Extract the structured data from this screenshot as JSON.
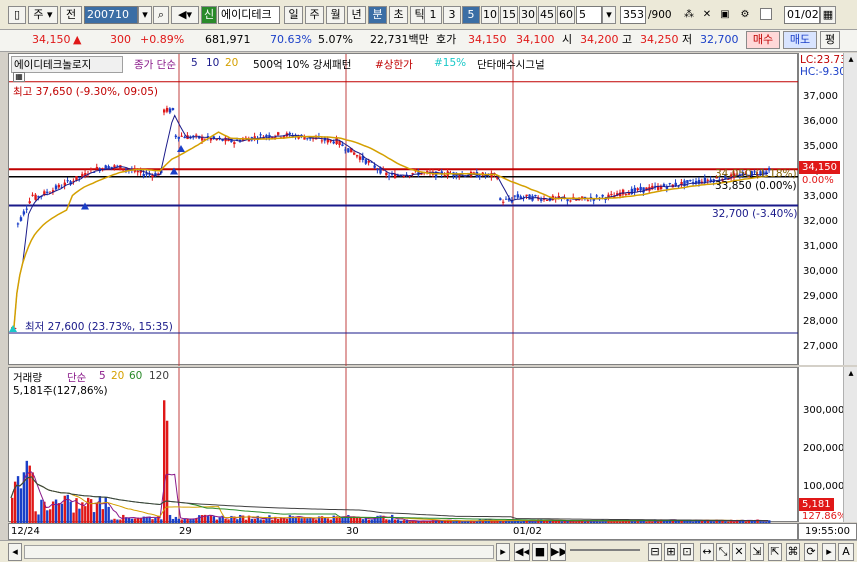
{
  "toolbar": {
    "market": "주",
    "range": "전",
    "code": "200710",
    "shin_label": "신",
    "stock_name": "에이디테크",
    "periods": [
      "일",
      "주",
      "월",
      "년",
      "분",
      "초",
      "틱"
    ],
    "active_period": "분",
    "intervals": [
      "1",
      "3",
      "5",
      "10",
      "15",
      "30",
      "45",
      "60"
    ],
    "active_interval": "5",
    "interval_select": "5",
    "count": "353",
    "count_total": "/900",
    "date": "01/02"
  },
  "quote": {
    "price": "34,150",
    "arrow": "▲",
    "change": "300",
    "change_pct": "+0.89%",
    "volume": "681,971",
    "ratio": "70.63%",
    "ratio2": "5.07%",
    "amount": "22,731백만",
    "hoga_label": "호가",
    "ask": "34,150",
    "bid": "34,100",
    "open_label": "시",
    "open": "34,200",
    "high_label": "고",
    "high": "34,250",
    "low_label": "저",
    "low": "32,700",
    "buy": "매수",
    "sell": "매도",
    "eval": "평"
  },
  "legend": {
    "name": "에이디테크놀로지",
    "ma_label": "종가 단순",
    "ma5": "5",
    "ma10": "10",
    "ma20": "20",
    "pattern": "500억 10% 강세패턴",
    "upper": "#상한가",
    "pct15": "#15%",
    "signal": "단타매수시그널"
  },
  "price_panel": {
    "lc": "LC:23.73",
    "hc": "HC:-9.30",
    "high_note": "최고 37,650 (-9.30%, 09:05)",
    "low_note": "최저 27,600 (23.73%, 15:35)",
    "ref_label": "32,700 (-3.40%)",
    "ref2_label": "33,850 (0.00%)",
    "ref3_label": "34,050 (1.18%)",
    "current_tag": "34,150",
    "current_pct": "0.00%",
    "yticks": [
      "37,000",
      "36,000",
      "35,000",
      "34,000",
      "33,000",
      "32,000",
      "31,000",
      "30,000",
      "29,000",
      "28,000",
      "27,000"
    ]
  },
  "volume_panel": {
    "title": "거래량",
    "ma_label": "단순",
    "ma5": "5",
    "ma20": "20",
    "ma60": "60",
    "ma120": "120",
    "current": "5,181주(127,86%)",
    "yticks": [
      "300,000",
      "200,000",
      "100,000"
    ],
    "tag": "5,181",
    "tag_pct": "127.86%"
  },
  "xaxis": {
    "labels": [
      "12/24",
      "29",
      "30",
      "01/02"
    ],
    "time": "19:55:00"
  },
  "colors": {
    "up": "#e01818",
    "down": "#1a3fc8",
    "ma5": "#1a1a8a",
    "ma20": "#d4a000",
    "ma60": "#2a8a2a",
    "ma120": "#404040",
    "accent": "#3b6ea5"
  }
}
